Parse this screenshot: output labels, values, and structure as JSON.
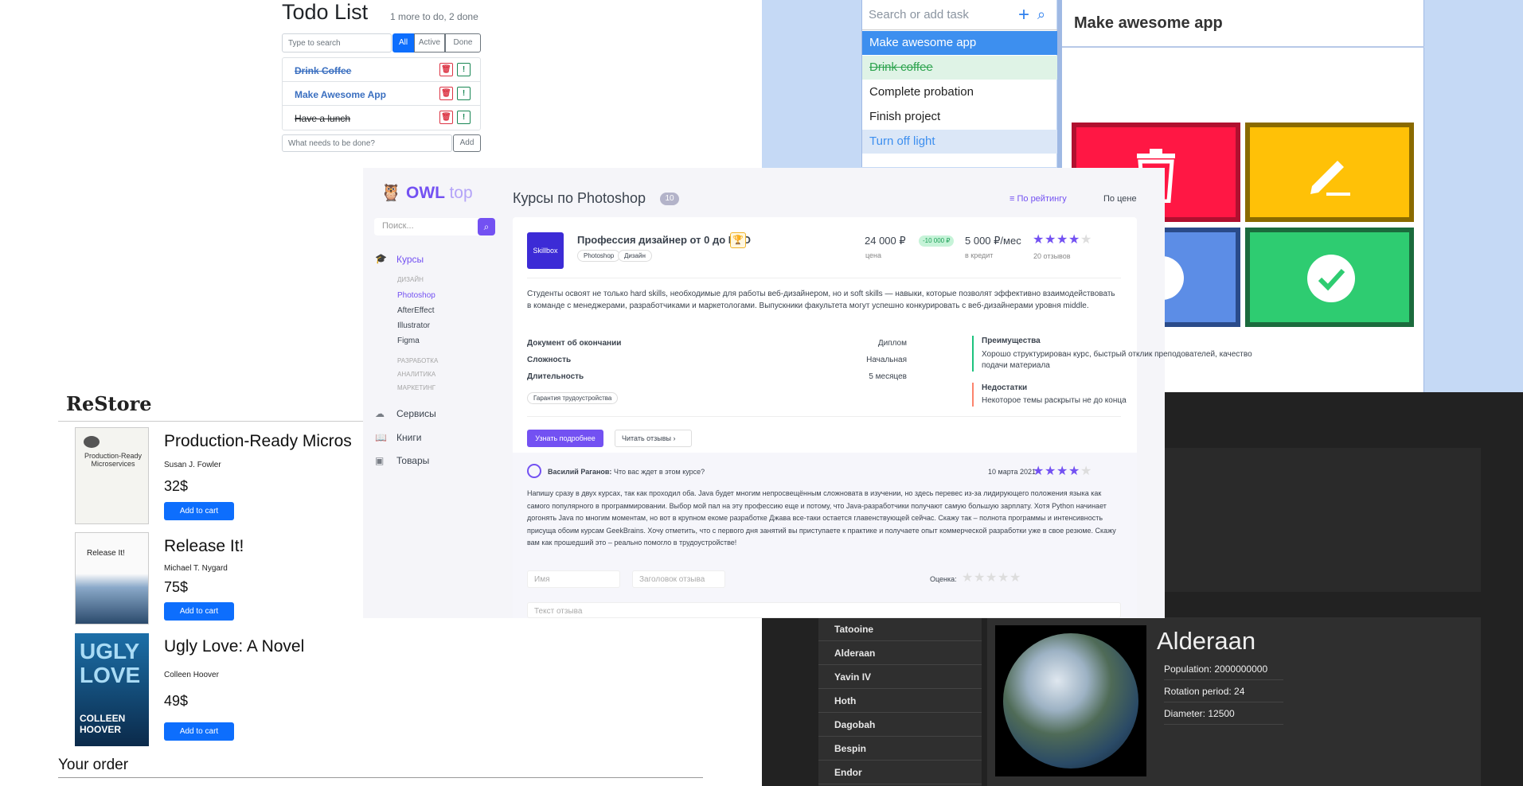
{
  "todo": {
    "title": "Todo List",
    "counter": "1 more to do, 2 done",
    "search_placeholder": "Type to search",
    "filters": [
      "All",
      "Active",
      "Done"
    ],
    "items": [
      "Drink Coffee",
      "Make Awesome App",
      "Have a lunch"
    ],
    "add_placeholder": "What needs to be done?",
    "add_label": "Add"
  },
  "awesome": {
    "search_placeholder": "Search or add task",
    "items": [
      "Make awesome app",
      "Drink coffee",
      "Complete probation",
      "Finish project",
      "Turn off light"
    ],
    "selected_title": "Make awesome app",
    "colors": {
      "red": "#ff1744",
      "yellow": "#ffc107",
      "blue": "#5c8de6",
      "green": "#2ecc71"
    }
  },
  "owl": {
    "logo_main": "OWL",
    "logo_sub": "top",
    "search_placeholder": "Поиск...",
    "nav": [
      "Курсы",
      "Сервисы",
      "Книги",
      "Товары"
    ],
    "categories": {
      "design": "ДИЗАЙН",
      "dev": "РАЗРАБОТКА",
      "analytics": "АНАЛИТИКА",
      "marketing": "МАРКЕТИНГ"
    },
    "design_items": [
      "Photoshop",
      "AfterEffect",
      "Illustrator",
      "Figma"
    ],
    "page_title": "Курсы по Photoshop",
    "count": "10",
    "sort_rating": "По рейтингу",
    "sort_price": "По цене",
    "course": {
      "logo": "Skillbox",
      "name": "Профессия дизайнер от 0 до PRO",
      "tags": [
        "Photoshop",
        "Дизайн"
      ],
      "price": "24 000 ₽",
      "discount": "-10 000 ₽",
      "price_label": "цена",
      "credit": "5 000 ₽/мес",
      "credit_label": "в кредит",
      "reviews": "20 отзывов",
      "description": "Студенты освоят не только hard skills, необходимые для работы веб-дизайнером, но и soft skills — навыки, которые позволят эффективно взаимодействовать в команде с менеджерами, разработчиками и маркетологами. Выпускники факультета могут успешно конкурировать с веб-дизайнерами уровня middle.",
      "specs": [
        {
          "label": "Документ об окончании",
          "value": "Диплом"
        },
        {
          "label": "Сложность",
          "value": "Начальная"
        },
        {
          "label": "Длительность",
          "value": "5 месяцев"
        }
      ],
      "guarantee": "Гарантия трудоустройства",
      "adv_title": "Преимущества",
      "adv_text": "Хорошо структурирован курс, быстрый отклик преподователей, качество подачи материала",
      "disadv_title": "Недостатки",
      "disadv_text": "Некоторое темы раскрыты не до конца",
      "more": "Узнать подробнее",
      "read_reviews": "Читать отзывы"
    },
    "review": {
      "author": "Василий Раганов:",
      "subject": "Что вас ждет в этом курсе?",
      "date": "10 марта 2021",
      "text": "Напишу сразу в двух курсах, так как проходил оба. Java будет многим непросвещённым сложновата в изучении, но здесь перевес из-за лидирующего положения языка как самого популярного в программировании. Выбор мой пал на эту профессию еще и потому, что Java-разработчики получают самую большую зарплату. Хотя Python начинает догонять Java по многим моментам, но вот в крупном екоме разработке Джава все-таки остается главенствующей сейчас. Скажу так – полнота программы и интенсивность присуща обоим курсам GeekBrains. Хочу отметить, что с первого дня занятий вы приступаете к практике и получаете опыт коммерческой разработки уже в свое резюме. Скажу вам как прошедший это – реально помогло в трудоустройстве!",
      "name_placeholder": "Имя",
      "title_placeholder": "Заголовок отзыва",
      "rating_label": "Оценка:",
      "text_placeholder": "Текст отзыва"
    }
  },
  "restore": {
    "brand": "ReStore",
    "books": [
      {
        "title": "Production-Ready Micros",
        "author": "Susan J. Fowler",
        "price": "32$"
      },
      {
        "title": "Release It!",
        "author": "Michael T. Nygard",
        "price": "75$"
      },
      {
        "title": "Ugly Love: A Novel",
        "author": "Colleen Hoover",
        "price": "49$"
      }
    ],
    "add_to_cart": "Add to cart",
    "your_order": "Your order"
  },
  "starwars": {
    "planets": [
      "Tatooine",
      "Alderaan",
      "Yavin IV",
      "Hoth",
      "Dagobah",
      "Bespin",
      "Endor"
    ],
    "selected": "Alderaan",
    "details": [
      "Population: 2000000000",
      "Rotation period: 24",
      "Diameter: 12500"
    ]
  }
}
